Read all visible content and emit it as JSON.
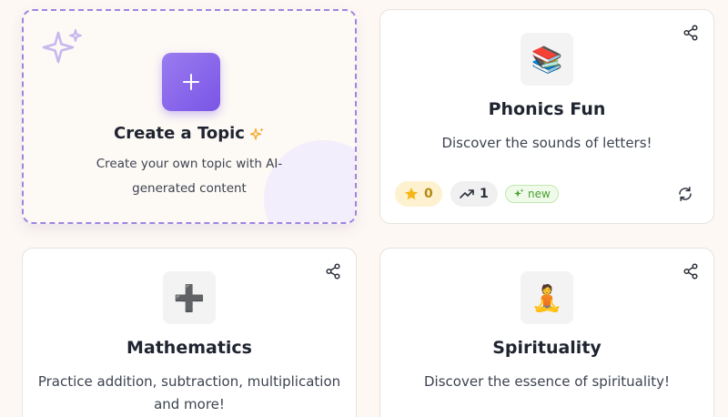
{
  "create_card": {
    "title": "Create a Topic",
    "description": "Create your own topic with AI-generated content",
    "plus_symbol": "+"
  },
  "topics": [
    {
      "emoji": "📚",
      "title": "Phonics Fun",
      "description": "Discover the sounds of letters!",
      "stars": "0",
      "trend_count": "1",
      "badge": "new"
    },
    {
      "emoji": "➕",
      "title": "Mathematics",
      "description": "Practice addition, subtraction, multiplication and more!"
    },
    {
      "emoji": "🧘",
      "title": "Spirituality",
      "description": "Discover the essence of spirituality!"
    }
  ],
  "colors": {
    "accent": "#7a55e6",
    "background": "#fdf8f4",
    "new_badge": "#4a9f2e",
    "star": "#f5b716"
  },
  "icons": [
    "sparkles-icon",
    "plus-icon",
    "share-icon",
    "star-icon",
    "trending-up-icon",
    "refresh-icon"
  ]
}
